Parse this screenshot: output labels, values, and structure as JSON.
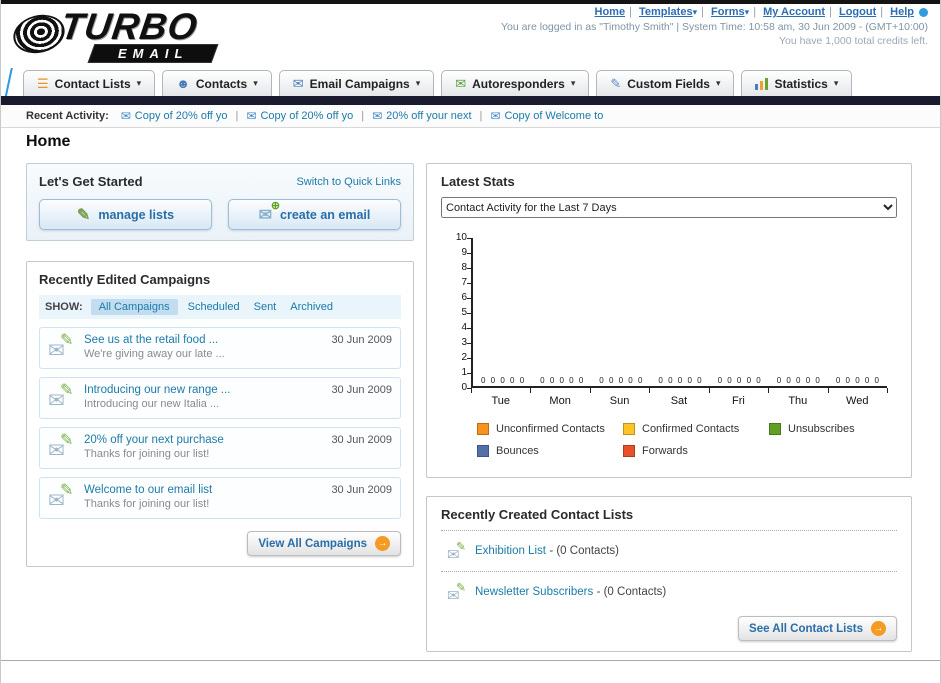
{
  "theme": {
    "accent_orange": "#f59a23",
    "link_teal": "#1b7ba9",
    "link_blue": "#2a6db5",
    "dark_bar": "#1b1b30"
  },
  "logo": {
    "line1": "TURBO",
    "line2": "EMAIL"
  },
  "header": {
    "top_links": [
      "Home",
      "Templates",
      "Forms",
      "My Account",
      "Logout",
      "Help"
    ],
    "login_info": "You are logged in as \"Timothy Smith\" | System Time: 10:58 am, 30 Jun 2009 - (GMT+10:00)",
    "credits": "You have 1,000 total credits left."
  },
  "nav": {
    "items": [
      {
        "label": "Contact Lists"
      },
      {
        "label": "Contacts"
      },
      {
        "label": "Email Campaigns"
      },
      {
        "label": "Autoresponders"
      },
      {
        "label": "Custom Fields"
      },
      {
        "label": "Statistics"
      }
    ]
  },
  "activity": {
    "label": "Recent Activity:",
    "items": [
      "Copy of 20% off yo",
      "Copy of 20% off yo",
      "20% off your next",
      "Copy of Welcome to"
    ]
  },
  "page_title": "Home",
  "get_started": {
    "title": "Let's Get Started",
    "switch_link": "Switch to Quick Links",
    "manage_label": "manage lists",
    "create_label": "create an email"
  },
  "campaigns": {
    "title": "Recently Edited Campaigns",
    "show_label": "SHOW:",
    "tabs": [
      "All Campaigns",
      "Scheduled",
      "Sent",
      "Archived"
    ],
    "rows": [
      {
        "title": "See us at the retail food ...",
        "subtitle": "We're giving away our late ...",
        "date": "30 Jun 2009"
      },
      {
        "title": "Introducing our new range ...",
        "subtitle": "Introducing our new Italia ...",
        "date": "30 Jun 2009"
      },
      {
        "title": "20% off your next purchase",
        "subtitle": "Thanks for joining our list!",
        "date": "30 Jun 2009"
      },
      {
        "title": "Welcome to our email list",
        "subtitle": "Thanks for joining our list!",
        "date": "30 Jun 2009"
      }
    ],
    "view_all_label": "View All Campaigns"
  },
  "stats": {
    "title": "Latest Stats",
    "dropdown_value": "Contact Activity for the Last 7 Days"
  },
  "chart_data": {
    "type": "bar",
    "title": "Contact Activity for the Last 7 Days",
    "categories": [
      "Tue",
      "Mon",
      "Sun",
      "Sat",
      "Fri",
      "Thu",
      "Wed"
    ],
    "series": [
      {
        "name": "Unconfirmed Contacts",
        "color": "#f7941d",
        "values": [
          0,
          0,
          0,
          0,
          0,
          0,
          0
        ]
      },
      {
        "name": "Confirmed Contacts",
        "color": "#fec425",
        "values": [
          0,
          0,
          0,
          0,
          0,
          0,
          0
        ]
      },
      {
        "name": "Unsubscribes",
        "color": "#61a024",
        "values": [
          0,
          0,
          0,
          0,
          0,
          0,
          0
        ]
      },
      {
        "name": "Bounces",
        "color": "#5470a8",
        "values": [
          0,
          0,
          0,
          0,
          0,
          0,
          0
        ]
      },
      {
        "name": "Forwards",
        "color": "#e8502a",
        "values": [
          0,
          0,
          0,
          0,
          0,
          0,
          0
        ]
      }
    ],
    "ylim": [
      0,
      10
    ],
    "yticks": [
      0,
      1,
      2,
      3,
      4,
      5,
      6,
      7,
      8,
      9,
      10
    ],
    "grid": false,
    "legend_position": "bottom"
  },
  "contact_lists": {
    "title": "Recently Created Contact Lists",
    "items": [
      {
        "name": "Exhibition List",
        "detail": "- (0 Contacts)"
      },
      {
        "name": "Newsletter Subscribers",
        "detail": "- (0 Contacts)"
      }
    ],
    "see_all_label": "See All Contact Lists"
  }
}
